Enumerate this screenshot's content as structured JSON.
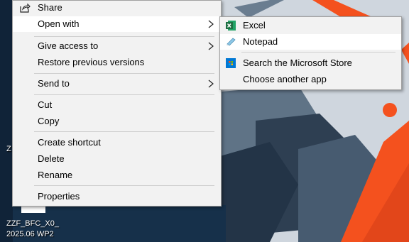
{
  "context_menu": {
    "share": "Share",
    "open_with": "Open with",
    "give_access_to": "Give access to",
    "restore_previous_versions": "Restore previous versions",
    "send_to": "Send to",
    "cut": "Cut",
    "copy": "Copy",
    "create_shortcut": "Create shortcut",
    "delete": "Delete",
    "rename": "Rename",
    "properties": "Properties"
  },
  "open_with_submenu": {
    "excel": "Excel",
    "notepad": "Notepad",
    "search_store": "Search the Microsoft Store",
    "choose_another_app": "Choose another app"
  },
  "desktop": {
    "icon_label_partial": "Z",
    "file_label_line1": "ZZF_BFC_X0_",
    "file_label_line2": "2025.06 WP2"
  },
  "colors": {
    "menu_bg": "#f2f2f2",
    "highlight_bg": "#ffffff",
    "accent_orange": "#f4511e",
    "excel_green": "#1d6f42",
    "store_blue": "#0078d4"
  }
}
